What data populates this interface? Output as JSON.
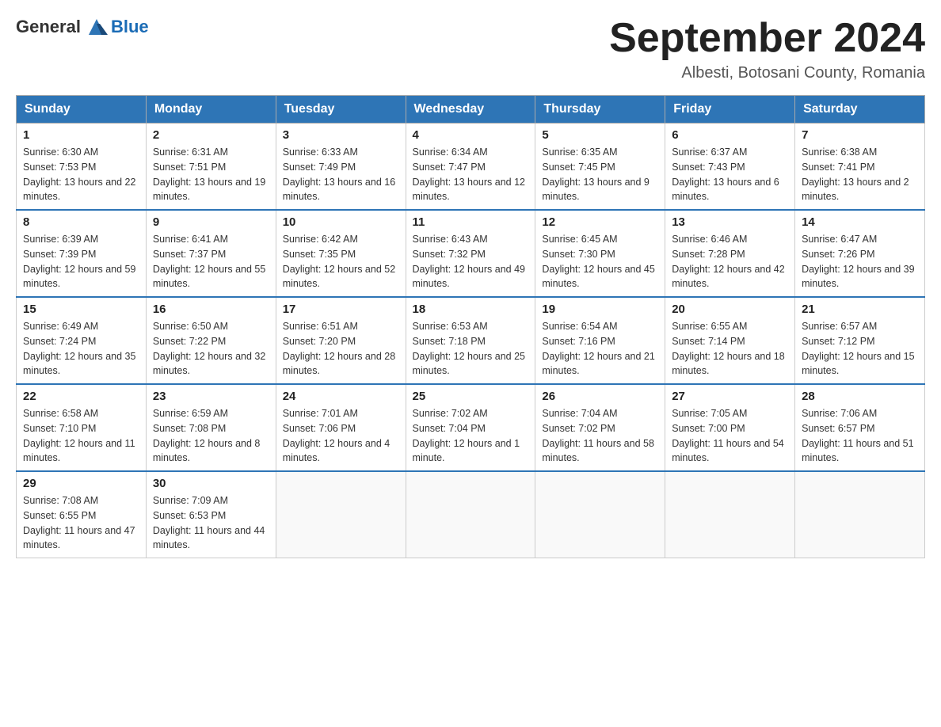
{
  "header": {
    "logo_general": "General",
    "logo_blue": "Blue",
    "title": "September 2024",
    "subtitle": "Albesti, Botosani County, Romania"
  },
  "days_of_week": [
    "Sunday",
    "Monday",
    "Tuesday",
    "Wednesday",
    "Thursday",
    "Friday",
    "Saturday"
  ],
  "weeks": [
    [
      {
        "day": "1",
        "sunrise": "6:30 AM",
        "sunset": "7:53 PM",
        "daylight": "13 hours and 22 minutes."
      },
      {
        "day": "2",
        "sunrise": "6:31 AM",
        "sunset": "7:51 PM",
        "daylight": "13 hours and 19 minutes."
      },
      {
        "day": "3",
        "sunrise": "6:33 AM",
        "sunset": "7:49 PM",
        "daylight": "13 hours and 16 minutes."
      },
      {
        "day": "4",
        "sunrise": "6:34 AM",
        "sunset": "7:47 PM",
        "daylight": "13 hours and 12 minutes."
      },
      {
        "day": "5",
        "sunrise": "6:35 AM",
        "sunset": "7:45 PM",
        "daylight": "13 hours and 9 minutes."
      },
      {
        "day": "6",
        "sunrise": "6:37 AM",
        "sunset": "7:43 PM",
        "daylight": "13 hours and 6 minutes."
      },
      {
        "day": "7",
        "sunrise": "6:38 AM",
        "sunset": "7:41 PM",
        "daylight": "13 hours and 2 minutes."
      }
    ],
    [
      {
        "day": "8",
        "sunrise": "6:39 AM",
        "sunset": "7:39 PM",
        "daylight": "12 hours and 59 minutes."
      },
      {
        "day": "9",
        "sunrise": "6:41 AM",
        "sunset": "7:37 PM",
        "daylight": "12 hours and 55 minutes."
      },
      {
        "day": "10",
        "sunrise": "6:42 AM",
        "sunset": "7:35 PM",
        "daylight": "12 hours and 52 minutes."
      },
      {
        "day": "11",
        "sunrise": "6:43 AM",
        "sunset": "7:32 PM",
        "daylight": "12 hours and 49 minutes."
      },
      {
        "day": "12",
        "sunrise": "6:45 AM",
        "sunset": "7:30 PM",
        "daylight": "12 hours and 45 minutes."
      },
      {
        "day": "13",
        "sunrise": "6:46 AM",
        "sunset": "7:28 PM",
        "daylight": "12 hours and 42 minutes."
      },
      {
        "day": "14",
        "sunrise": "6:47 AM",
        "sunset": "7:26 PM",
        "daylight": "12 hours and 39 minutes."
      }
    ],
    [
      {
        "day": "15",
        "sunrise": "6:49 AM",
        "sunset": "7:24 PM",
        "daylight": "12 hours and 35 minutes."
      },
      {
        "day": "16",
        "sunrise": "6:50 AM",
        "sunset": "7:22 PM",
        "daylight": "12 hours and 32 minutes."
      },
      {
        "day": "17",
        "sunrise": "6:51 AM",
        "sunset": "7:20 PM",
        "daylight": "12 hours and 28 minutes."
      },
      {
        "day": "18",
        "sunrise": "6:53 AM",
        "sunset": "7:18 PM",
        "daylight": "12 hours and 25 minutes."
      },
      {
        "day": "19",
        "sunrise": "6:54 AM",
        "sunset": "7:16 PM",
        "daylight": "12 hours and 21 minutes."
      },
      {
        "day": "20",
        "sunrise": "6:55 AM",
        "sunset": "7:14 PM",
        "daylight": "12 hours and 18 minutes."
      },
      {
        "day": "21",
        "sunrise": "6:57 AM",
        "sunset": "7:12 PM",
        "daylight": "12 hours and 15 minutes."
      }
    ],
    [
      {
        "day": "22",
        "sunrise": "6:58 AM",
        "sunset": "7:10 PM",
        "daylight": "12 hours and 11 minutes."
      },
      {
        "day": "23",
        "sunrise": "6:59 AM",
        "sunset": "7:08 PM",
        "daylight": "12 hours and 8 minutes."
      },
      {
        "day": "24",
        "sunrise": "7:01 AM",
        "sunset": "7:06 PM",
        "daylight": "12 hours and 4 minutes."
      },
      {
        "day": "25",
        "sunrise": "7:02 AM",
        "sunset": "7:04 PM",
        "daylight": "12 hours and 1 minute."
      },
      {
        "day": "26",
        "sunrise": "7:04 AM",
        "sunset": "7:02 PM",
        "daylight": "11 hours and 58 minutes."
      },
      {
        "day": "27",
        "sunrise": "7:05 AM",
        "sunset": "7:00 PM",
        "daylight": "11 hours and 54 minutes."
      },
      {
        "day": "28",
        "sunrise": "7:06 AM",
        "sunset": "6:57 PM",
        "daylight": "11 hours and 51 minutes."
      }
    ],
    [
      {
        "day": "29",
        "sunrise": "7:08 AM",
        "sunset": "6:55 PM",
        "daylight": "11 hours and 47 minutes."
      },
      {
        "day": "30",
        "sunrise": "7:09 AM",
        "sunset": "6:53 PM",
        "daylight": "11 hours and 44 minutes."
      },
      null,
      null,
      null,
      null,
      null
    ]
  ],
  "labels": {
    "sunrise": "Sunrise:",
    "sunset": "Sunset:",
    "daylight": "Daylight:"
  }
}
